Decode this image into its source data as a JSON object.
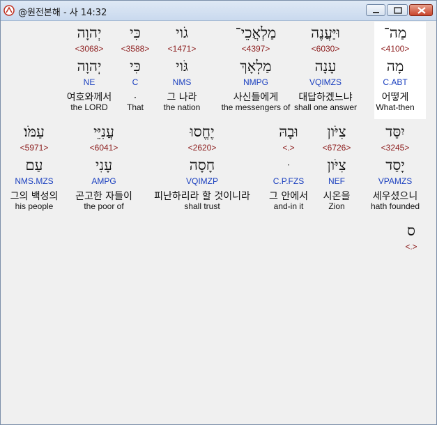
{
  "window": {
    "title": "@원전본해 - 사 14:32",
    "controls": {
      "minimize": "minimize",
      "maximize": "maximize",
      "close": "close"
    },
    "titlebar_color": "#c9d9ee",
    "close_color": "#c9452c"
  },
  "colors": {
    "strong": "#8b1a1a",
    "parse": "#1a3fbf",
    "text": "#111111",
    "highlight": "#ffffff"
  },
  "rows": [
    {
      "words": [
        {
          "heb": "מַה־",
          "strong": "<4100>",
          "heb_lemma": "מָה",
          "parse": "C.ABT",
          "kor": "어떻게",
          "eng": "What-then",
          "highlighted": true
        },
        {
          "heb": "וּיַּעֲנֶה",
          "strong": "<6030>",
          "heb_lemma": "עָנָה",
          "parse": "VQIMZS",
          "kor": "대답하겠느냐",
          "eng": "shall one answer"
        },
        {
          "heb": "מַלְאֲכֵי־",
          "strong": "<4397>",
          "heb_lemma": "מַלְאָךְ",
          "parse": "NMPG",
          "kor": "사신들에게",
          "eng": "the messengers of"
        },
        {
          "heb": "גֹוי",
          "strong": "<1471>",
          "heb_lemma": "גֹּוי",
          "parse": "NMS",
          "kor": "그 나라",
          "eng": "the nation"
        },
        {
          "heb": "כִּי",
          "strong": "<3588>",
          "heb_lemma": "כִּי",
          "parse": "C",
          "kor": ".",
          "eng": "That"
        },
        {
          "heb": "יְהוָה",
          "strong": "<3068>",
          "heb_lemma": "יְהוָה",
          "parse": "NE",
          "kor": "여호와께서",
          "eng": "the LORD"
        }
      ]
    },
    {
      "words": [
        {
          "heb": "יִסַּד",
          "strong": "<3245>",
          "heb_lemma": "יָסַד",
          "parse": "VPAMZS",
          "kor": "세우셨으니",
          "eng": "hath founded"
        },
        {
          "heb": "צִיֹּון",
          "strong": "<6726>",
          "heb_lemma": "צִיֹּון",
          "parse": "NEF",
          "kor": "시온을",
          "eng": "Zion"
        },
        {
          "heb": "וּבָהּ",
          "strong": "<.>",
          "heb_lemma": "ּ",
          "parse": "C.P.FZS",
          "kor": "그 안에서",
          "eng": "and-in it"
        },
        {
          "heb": "יֶחֱסוּ",
          "strong": "<2620>",
          "heb_lemma": "חָסָה",
          "parse": "VQIMZP",
          "kor": "피난하리라 할 것이니라",
          "eng": "shall trust"
        },
        {
          "heb": "עֲנִיֵּי",
          "strong": "<6041>",
          "heb_lemma": "עָנִי",
          "parse": "AMPG",
          "kor": "곤고한 자들이",
          "eng": "the poor of"
        },
        {
          "heb": "עַמֹּו׃",
          "strong": "<5971>",
          "heb_lemma": "עַם",
          "parse": "NMS.MZS",
          "kor": "그의 백성의",
          "eng": "his people"
        }
      ]
    },
    {
      "words": [
        {
          "heb": "ס",
          "strong": "<.>",
          "heb_lemma": "",
          "parse": "",
          "kor": "",
          "eng": ""
        }
      ]
    }
  ]
}
